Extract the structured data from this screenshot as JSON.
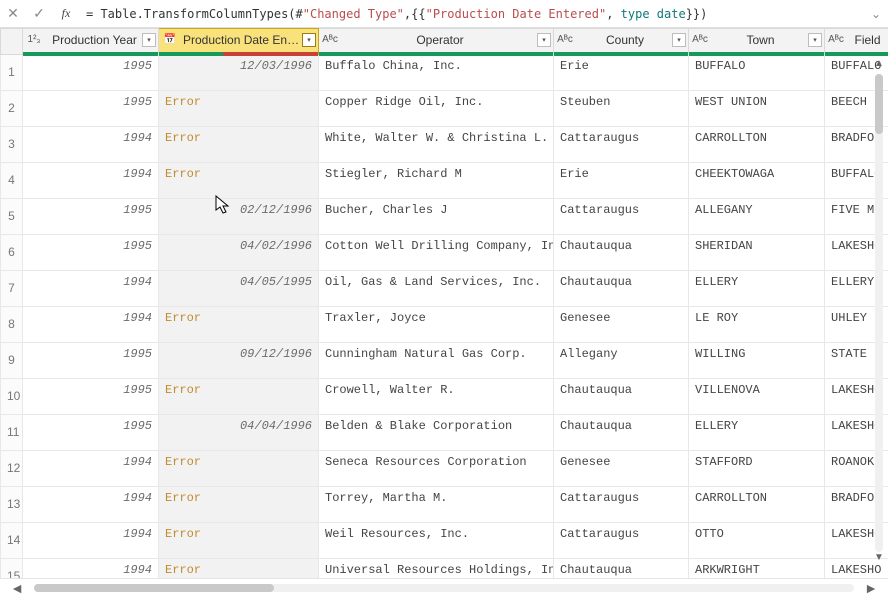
{
  "formula_bar": {
    "cancel_icon": "✕",
    "confirm_icon": "✓",
    "fx_label": "fx",
    "expand_icon": "⌄",
    "text_before": "= Table.TransformColumnTypes(#",
    "text_str1": "\"Changed Type\"",
    "text_mid": ",{{",
    "text_str2": "\"Production Date Entered\"",
    "text_mid2": ", ",
    "text_type": "type date",
    "text_after": "}})"
  },
  "columns": {
    "year": {
      "label": "Production Year",
      "type_icon": "1²₃"
    },
    "date": {
      "label": "Production Date Entered",
      "type_icon": "📅"
    },
    "op": {
      "label": "Operator",
      "type_icon": "Aᴮc"
    },
    "county": {
      "label": "County",
      "type_icon": "Aᴮc"
    },
    "town": {
      "label": "Town",
      "type_icon": "Aᴮc"
    },
    "field": {
      "label": "Field",
      "type_icon": "Aᴮc"
    }
  },
  "error_label": "Error",
  "rows": [
    {
      "n": "1",
      "year": "1995",
      "date": "12/03/1996",
      "err": false,
      "op": "Buffalo China, Inc.",
      "county": "Erie",
      "town": "BUFFALO",
      "field": "BUFFALO"
    },
    {
      "n": "2",
      "year": "1995",
      "date": "",
      "err": true,
      "op": "Copper Ridge Oil, Inc.",
      "county": "Steuben",
      "town": "WEST UNION",
      "field": "BEECH H"
    },
    {
      "n": "3",
      "year": "1994",
      "date": "",
      "err": true,
      "op": "White, Walter W. & Christina L.",
      "county": "Cattaraugus",
      "town": "CARROLLTON",
      "field": "BRADFOR"
    },
    {
      "n": "4",
      "year": "1994",
      "date": "",
      "err": true,
      "op": "Stiegler, Richard M",
      "county": "Erie",
      "town": "CHEEKTOWAGA",
      "field": "BUFFALO"
    },
    {
      "n": "5",
      "year": "1995",
      "date": "02/12/1996",
      "err": false,
      "op": "Bucher, Charles J",
      "county": "Cattaraugus",
      "town": "ALLEGANY",
      "field": "FIVE MI"
    },
    {
      "n": "6",
      "year": "1995",
      "date": "04/02/1996",
      "err": false,
      "op": "Cotton Well Drilling Company,  Inc.",
      "county": "Chautauqua",
      "town": "SHERIDAN",
      "field": "LAKESHO"
    },
    {
      "n": "7",
      "year": "1994",
      "date": "04/05/1995",
      "err": false,
      "op": "Oil, Gas & Land Services, Inc.",
      "county": "Chautauqua",
      "town": "ELLERY",
      "field": "ELLERY"
    },
    {
      "n": "8",
      "year": "1994",
      "date": "",
      "err": true,
      "op": "Traxler, Joyce",
      "county": "Genesee",
      "town": "LE ROY",
      "field": "UHLEY ("
    },
    {
      "n": "9",
      "year": "1995",
      "date": "09/12/1996",
      "err": false,
      "op": "Cunningham Natural Gas Corp.",
      "county": "Allegany",
      "town": "WILLING",
      "field": "STATE L"
    },
    {
      "n": "10",
      "year": "1995",
      "date": "",
      "err": true,
      "op": "Crowell, Walter R.",
      "county": "Chautauqua",
      "town": "VILLENOVA",
      "field": "LAKESHO"
    },
    {
      "n": "11",
      "year": "1995",
      "date": "04/04/1996",
      "err": false,
      "op": "Belden & Blake Corporation",
      "county": "Chautauqua",
      "town": "ELLERY",
      "field": "LAKESHO"
    },
    {
      "n": "12",
      "year": "1994",
      "date": "",
      "err": true,
      "op": "Seneca Resources Corporation",
      "county": "Genesee",
      "town": "STAFFORD",
      "field": "ROANOKE"
    },
    {
      "n": "13",
      "year": "1994",
      "date": "",
      "err": true,
      "op": "Torrey, Martha M.",
      "county": "Cattaraugus",
      "town": "CARROLLTON",
      "field": "BRADFOR"
    },
    {
      "n": "14",
      "year": "1994",
      "date": "",
      "err": true,
      "op": "Weil Resources, Inc.",
      "county": "Cattaraugus",
      "town": "OTTO",
      "field": "LAKESHO"
    },
    {
      "n": "15",
      "year": "1994",
      "date": "",
      "err": true,
      "op": "Universal Resources Holdings, Incorp…",
      "county": "Chautauqua",
      "town": "ARKWRIGHT",
      "field": "LAKESHO"
    }
  ]
}
